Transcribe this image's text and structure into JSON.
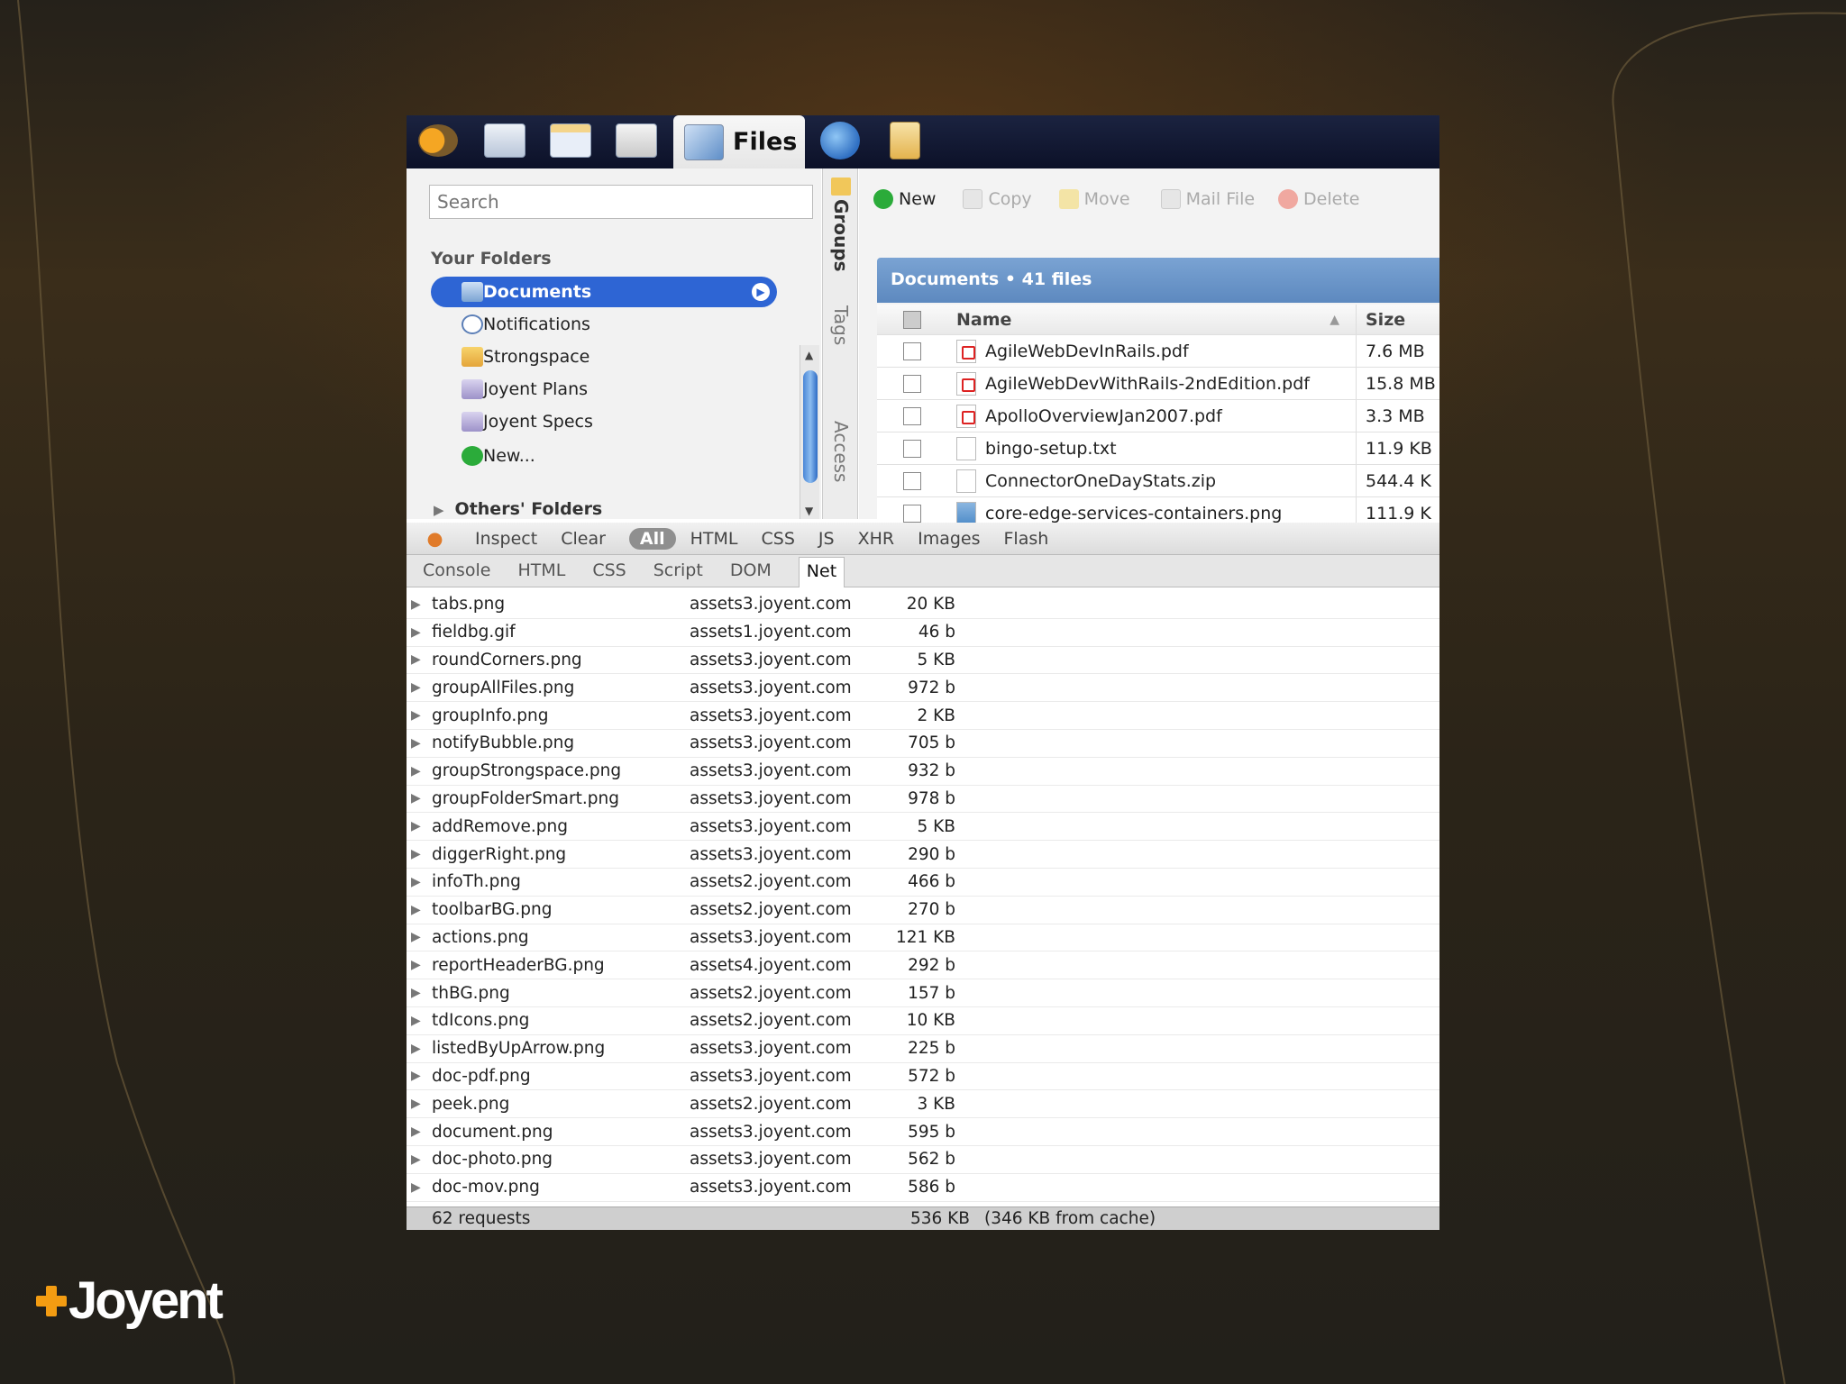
{
  "brand": {
    "logo_text": "Joyent",
    "accent": "#f39c12"
  },
  "tabs": {
    "files_label": "Files"
  },
  "sidebar": {
    "search_placeholder": "Search",
    "your_folders": "Your Folders",
    "folders": [
      {
        "label": "Documents",
        "icon": "documents-folder-icon",
        "active": true
      },
      {
        "label": "Notifications",
        "icon": "notifications-icon"
      },
      {
        "label": "Strongspace",
        "icon": "strongspace-folder-icon"
      },
      {
        "label": "Joyent Plans",
        "icon": "smart-folder-icon"
      },
      {
        "label": "Joyent Specs",
        "icon": "smart-folder-icon"
      },
      {
        "label": "New...",
        "icon": "add-icon"
      }
    ],
    "others_folders": "Others' Folders"
  },
  "vertical_tabs": {
    "groups": "Groups",
    "tags": "Tags",
    "access": "Access"
  },
  "toolbar": {
    "new": "New",
    "copy": "Copy",
    "move": "Move",
    "mail_file": "Mail File",
    "delete": "Delete"
  },
  "documents": {
    "title": "Documents",
    "count": "41 files",
    "columns": {
      "name": "Name",
      "size": "Size"
    },
    "files": [
      {
        "name": "AgileWebDevInRails.pdf",
        "size": "7.6 MB",
        "type": "pdf"
      },
      {
        "name": "AgileWebDevWithRails-2ndEdition.pdf",
        "size": "15.8 MB",
        "type": "pdf"
      },
      {
        "name": "ApolloOverviewJan2007.pdf",
        "size": "3.3 MB",
        "type": "pdf"
      },
      {
        "name": "bingo-setup.txt",
        "size": "11.9 KB",
        "type": "txt"
      },
      {
        "name": "ConnectorOneDayStats.zip",
        "size": "544.4 K",
        "type": "zip"
      },
      {
        "name": "core-edge-services-containers.png",
        "size": "111.9 K",
        "type": "png"
      }
    ]
  },
  "firebug": {
    "toolbar": {
      "inspect": "Inspect",
      "clear": "Clear",
      "all": "All",
      "html": "HTML",
      "css": "CSS",
      "js": "JS",
      "xhr": "XHR",
      "images": "Images",
      "flash": "Flash"
    },
    "tabs": {
      "console": "Console",
      "html": "HTML",
      "css": "CSS",
      "script": "Script",
      "dom": "DOM",
      "net": "Net"
    },
    "requests": [
      {
        "file": "tabs.png",
        "host": "assets3.joyent.com",
        "size": "20 KB"
      },
      {
        "file": "fieldbg.gif",
        "host": "assets1.joyent.com",
        "size": "46 b"
      },
      {
        "file": "roundCorners.png",
        "host": "assets3.joyent.com",
        "size": "5 KB"
      },
      {
        "file": "groupAllFiles.png",
        "host": "assets3.joyent.com",
        "size": "972 b"
      },
      {
        "file": "groupInfo.png",
        "host": "assets3.joyent.com",
        "size": "2 KB"
      },
      {
        "file": "notifyBubble.png",
        "host": "assets3.joyent.com",
        "size": "705 b"
      },
      {
        "file": "groupStrongspace.png",
        "host": "assets3.joyent.com",
        "size": "932 b"
      },
      {
        "file": "groupFolderSmart.png",
        "host": "assets3.joyent.com",
        "size": "978 b"
      },
      {
        "file": "addRemove.png",
        "host": "assets3.joyent.com",
        "size": "5 KB"
      },
      {
        "file": "diggerRight.png",
        "host": "assets3.joyent.com",
        "size": "290 b"
      },
      {
        "file": "infoTh.png",
        "host": "assets2.joyent.com",
        "size": "466 b"
      },
      {
        "file": "toolbarBG.png",
        "host": "assets2.joyent.com",
        "size": "270 b"
      },
      {
        "file": "actions.png",
        "host": "assets3.joyent.com",
        "size": "121 KB"
      },
      {
        "file": "reportHeaderBG.png",
        "host": "assets4.joyent.com",
        "size": "292 b"
      },
      {
        "file": "thBG.png",
        "host": "assets2.joyent.com",
        "size": "157 b"
      },
      {
        "file": "tdIcons.png",
        "host": "assets2.joyent.com",
        "size": "10 KB"
      },
      {
        "file": "listedByUpArrow.png",
        "host": "assets3.joyent.com",
        "size": "225 b"
      },
      {
        "file": "doc-pdf.png",
        "host": "assets3.joyent.com",
        "size": "572 b"
      },
      {
        "file": "peek.png",
        "host": "assets2.joyent.com",
        "size": "3 KB"
      },
      {
        "file": "document.png",
        "host": "assets3.joyent.com",
        "size": "595 b"
      },
      {
        "file": "doc-photo.png",
        "host": "assets3.joyent.com",
        "size": "562 b"
      },
      {
        "file": "doc-mov.png",
        "host": "assets3.joyent.com",
        "size": "586 b"
      }
    ],
    "footer": {
      "requests": "62 requests",
      "total": "536 KB",
      "cache": "(346 KB from cache)"
    }
  }
}
